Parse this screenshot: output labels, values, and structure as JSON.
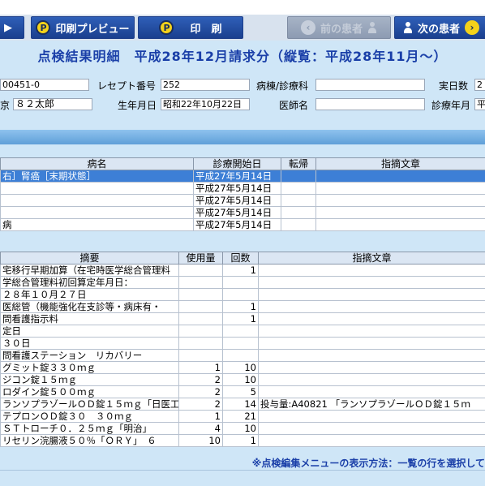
{
  "toolbar": {
    "preview_label": "印刷プレビュー",
    "print_label": "印　刷",
    "prev_patient_label": "前の患者",
    "next_patient_label": "次の患者"
  },
  "header": {
    "title": "点検結果明細　平成28年12月請求分（縦覧：平成28年11月〜）"
  },
  "info": {
    "patient_id": "00451-0",
    "receipt_no_label": "レセプト番号",
    "receipt_no": "252",
    "ward_label": "病棟/診療科",
    "ward": "",
    "actual_days_label": "実日数",
    "actual_days": "2",
    "patient_name_prefix": "京",
    "patient_name": "８２太郎",
    "dob_label": "生年月日",
    "dob": "昭和22年10月22日",
    "doctor_label": "医師名",
    "doctor": "",
    "treatment_ym_label": "診療年月",
    "treatment_ym": "平"
  },
  "disease_table": {
    "headers": [
      "病名",
      "診療開始日",
      "転帰",
      "指摘文章"
    ],
    "rows": [
      {
        "name": "右］腎癌［末期状態］",
        "start": "平成27年5月14日",
        "outcome": "",
        "note": ""
      },
      {
        "name": "",
        "start": "平成27年5月14日",
        "outcome": "",
        "note": ""
      },
      {
        "name": "",
        "start": "平成27年5月14日",
        "outcome": "",
        "note": ""
      },
      {
        "name": "",
        "start": "平成27年5月14日",
        "outcome": "",
        "note": ""
      },
      {
        "name": "病",
        "start": "平成27年5月14日",
        "outcome": "",
        "note": ""
      }
    ]
  },
  "detail_table": {
    "headers": [
      "摘要",
      "使用量",
      "回数",
      "指摘文章"
    ],
    "rows": [
      {
        "summary": "宅移行早期加算（在宅時医学総合管理料",
        "usage": "",
        "count": "1",
        "note": ""
      },
      {
        "summary": "学総合管理料初回算定年月日：",
        "usage": "",
        "count": "",
        "note": ""
      },
      {
        "summary": "２８年１０月２７日",
        "usage": "",
        "count": "",
        "note": ""
      },
      {
        "summary": "医総管（機能強化在支診等・病床有・",
        "usage": "",
        "count": "1",
        "note": ""
      },
      {
        "summary": "問看護指示料",
        "usage": "",
        "count": "1",
        "note": ""
      },
      {
        "summary": "定日",
        "usage": "",
        "count": "",
        "note": ""
      },
      {
        "summary": "３０日",
        "usage": "",
        "count": "",
        "note": ""
      },
      {
        "summary": "問看護ステーション　リカバリー",
        "usage": "",
        "count": "",
        "note": ""
      },
      {
        "summary": "グミット錠３３０ｍｇ",
        "usage": "1",
        "count": "10",
        "note": ""
      },
      {
        "summary": "ジコン錠１５ｍｇ",
        "usage": "2",
        "count": "10",
        "note": ""
      },
      {
        "summary": "ロダイン錠５００ｍｇ",
        "usage": "2",
        "count": "5",
        "note": ""
      },
      {
        "summary": "ランソプラゾールＯＤ錠１５ｍｇ「日医工",
        "usage": "2",
        "count": "14",
        "note": "投与量:A40821 「ランソプラゾールＯＤ錠１５ｍ"
      },
      {
        "summary": "テプロンＯＤ錠３０　３０ｍｇ",
        "usage": "1",
        "count": "21",
        "note": ""
      },
      {
        "summary": "ＳＴトローチ０．２５ｍｇ「明治」",
        "usage": "4",
        "count": "10",
        "note": ""
      },
      {
        "summary": "リセリン浣腸液５０％「ＯＲＹ」　６",
        "usage": "10",
        "count": "1",
        "note": ""
      }
    ]
  },
  "footnote": "※点検編集メニューの表示方法：一覧の行を選択して"
}
